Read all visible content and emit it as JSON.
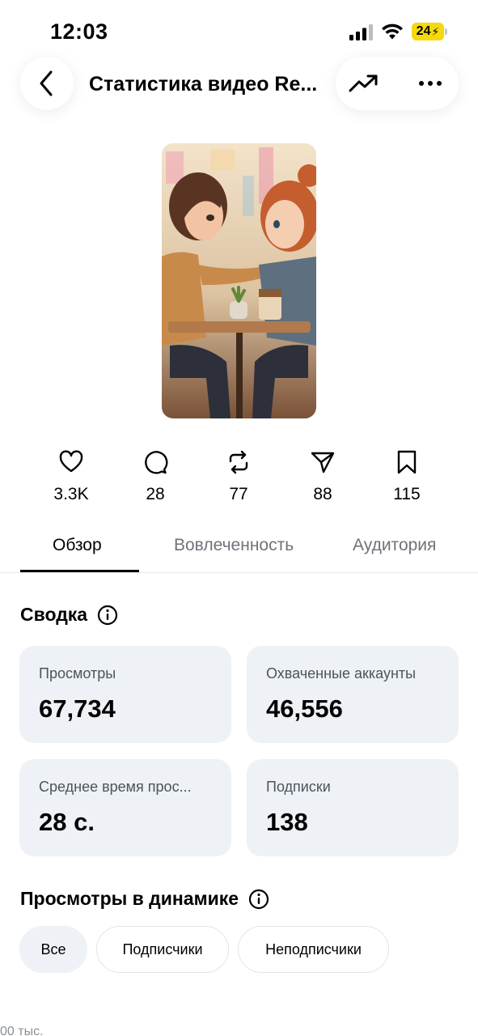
{
  "status_bar": {
    "time": "12:03",
    "battery": "24"
  },
  "header": {
    "title": "Статистика видео Re...",
    "back_icon": "chevron-left-icon",
    "trend_icon": "trend-up-icon",
    "more_icon": "more-horizontal-icon"
  },
  "stats": [
    {
      "icon": "heart-icon",
      "value": "3.3K"
    },
    {
      "icon": "comment-icon",
      "value": "28"
    },
    {
      "icon": "repost-icon",
      "value": "77"
    },
    {
      "icon": "send-icon",
      "value": "88"
    },
    {
      "icon": "bookmark-icon",
      "value": "115"
    }
  ],
  "tabs": [
    {
      "label": "Обзор",
      "active": true
    },
    {
      "label": "Вовлеченность",
      "active": false
    },
    {
      "label": "Аудитория",
      "active": false
    }
  ],
  "summary": {
    "title": "Сводка",
    "cards": [
      {
        "label": "Просмотры",
        "value": "67,734"
      },
      {
        "label": "Охваченные аккаунты",
        "value": "46,556"
      },
      {
        "label": "Среднее время прос...",
        "value": "28 с."
      },
      {
        "label": "Подписки",
        "value": "138"
      }
    ]
  },
  "views_dynamics": {
    "title": "Просмотры в динамике",
    "filters": [
      {
        "label": "Все",
        "selected": true
      },
      {
        "label": "Подписчики",
        "selected": false
      },
      {
        "label": "Неподписчики",
        "selected": false
      }
    ],
    "cut_off_text": "00 тыс."
  },
  "colors": {
    "card_bg": "#eef1f5",
    "battery": "#f5d90a",
    "muted_text": "#6e7379"
  }
}
